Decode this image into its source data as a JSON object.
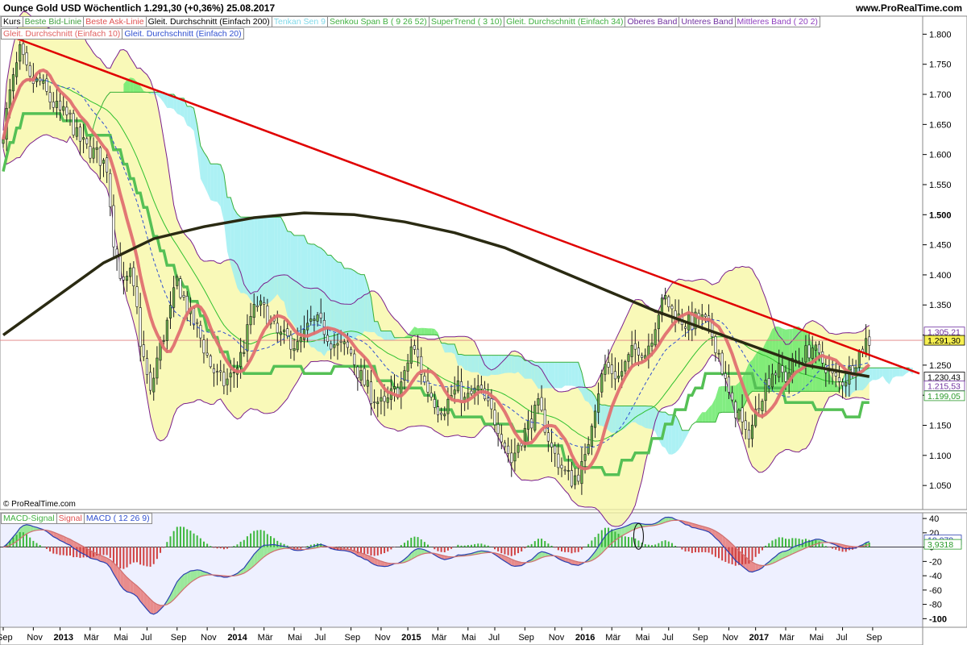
{
  "header": {
    "title": "Ounce Gold USD   Wöchentlich   1.291,30 (+0,36%)   25.08.2017",
    "site": "www.ProRealTime.com"
  },
  "legend_main": [
    {
      "label": "Kurs",
      "color": "#000000"
    },
    {
      "label": "Beste Bid-Linie",
      "color": "#40a040"
    },
    {
      "label": "Beste Ask-Linie",
      "color": "#e05050"
    },
    {
      "label": "Gleit. Durchschnitt (Einfach 200)",
      "color": "#000000"
    },
    {
      "label": "Tenkan Sen 9",
      "color": "#7fd8e8"
    },
    {
      "label": "Senkou Span B ( 9 26 52)",
      "color": "#40b040"
    },
    {
      "label": "SuperTrend ( 3 10)",
      "color": "#40b040"
    },
    {
      "label": "Gleit. Durchschnitt (Einfach 34)",
      "color": "#40b040"
    },
    {
      "label": "Oberes Band",
      "color": "#7030a0"
    },
    {
      "label": "Unteres Band",
      "color": "#7030a0"
    },
    {
      "label": "Mittleres Band ( 20 2)",
      "color": "#9040c0"
    }
  ],
  "legend_main2": [
    {
      "label": "Gleit. Durchschnitt (Einfach 10)",
      "color": "#e06060"
    },
    {
      "label": "Gleit. Durchschnitt (Einfach 20)",
      "color": "#3050d0"
    }
  ],
  "legend_macd": [
    {
      "label": "MACD-Signal",
      "color": "#40b040"
    },
    {
      "label": "Signal",
      "color": "#e05050"
    },
    {
      "label": "MACD ( 12 26 9)",
      "color": "#3050d0"
    }
  ],
  "copyright": "© ProRealTime.com",
  "colors": {
    "up": "#3fa33f",
    "down": "#222222",
    "trend": "#e00000",
    "ma200": "#2a2a12",
    "ma10": "#e07070",
    "ma20": "#3050d0",
    "supertrend": "#55c055",
    "boll_fill": "#f7f7a0",
    "boll_line": "#7a1f8c",
    "cloud_green": "#6cea6c",
    "cloud_cyan": "#9eeef2",
    "macd": "#2b3fb0",
    "signal": "#d07070",
    "hist_up": "#3cb83c",
    "hist_down": "#d04040"
  },
  "chart_data": {
    "type": "candlestick",
    "price_ticks": [
      "1.800",
      "1.750",
      "1.700",
      "1.650",
      "1.600",
      "1.550",
      "1.500",
      "1.450",
      "1.400",
      "1.350",
      "1.300",
      "1.250",
      "1.200",
      "1.150",
      "1.100",
      "1.050"
    ],
    "price_bold_tick": "1.500",
    "ylim": [
      1010,
      1830
    ],
    "macd_ticks": [
      "40",
      "20",
      "0",
      "-20",
      "-40",
      "-60",
      "-80",
      "-100"
    ],
    "macd_ylim": [
      -112,
      48
    ],
    "x_ticks": [
      {
        "week": 0,
        "label": "Sep"
      },
      {
        "week": 9,
        "label": "Nov"
      },
      {
        "week": 17,
        "label": "2013",
        "bold": true
      },
      {
        "week": 26,
        "label": "Mär"
      },
      {
        "week": 35,
        "label": "Mai"
      },
      {
        "week": 43,
        "label": "Jul"
      },
      {
        "week": 52,
        "label": "Sep"
      },
      {
        "week": 61,
        "label": "Nov"
      },
      {
        "week": 69,
        "label": "2014",
        "bold": true
      },
      {
        "week": 78,
        "label": "Mär"
      },
      {
        "week": 87,
        "label": "Mai"
      },
      {
        "week": 95,
        "label": "Jul"
      },
      {
        "week": 104,
        "label": "Sep"
      },
      {
        "week": 113,
        "label": "Nov"
      },
      {
        "week": 121,
        "label": "2015",
        "bold": true
      },
      {
        "week": 130,
        "label": "Mär"
      },
      {
        "week": 139,
        "label": "Mai"
      },
      {
        "week": 147,
        "label": "Jul"
      },
      {
        "week": 156,
        "label": "Sep"
      },
      {
        "week": 165,
        "label": "Nov"
      },
      {
        "week": 173,
        "label": "2016",
        "bold": true
      },
      {
        "week": 182,
        "label": "Mär"
      },
      {
        "week": 191,
        "label": "Mai"
      },
      {
        "week": 199,
        "label": "Jul"
      },
      {
        "week": 208,
        "label": "Sep"
      },
      {
        "week": 217,
        "label": "Nov"
      },
      {
        "week": 225,
        "label": "2017",
        "bold": true
      },
      {
        "week": 234,
        "label": "Mär"
      },
      {
        "week": 243,
        "label": "Mai"
      },
      {
        "week": 251,
        "label": "Jul"
      },
      {
        "week": 260,
        "label": "Sep"
      }
    ],
    "weeks_total": 274,
    "close_anchors": [
      [
        0,
        1640
      ],
      [
        2,
        1700
      ],
      [
        5,
        1770
      ],
      [
        8,
        1720
      ],
      [
        11,
        1720
      ],
      [
        14,
        1690
      ],
      [
        17,
        1670
      ],
      [
        20,
        1660
      ],
      [
        22,
        1630
      ],
      [
        25,
        1610
      ],
      [
        28,
        1600
      ],
      [
        31,
        1580
      ],
      [
        33,
        1460
      ],
      [
        34,
        1430
      ],
      [
        36,
        1380
      ],
      [
        38,
        1400
      ],
      [
        40,
        1340
      ],
      [
        41,
        1290
      ],
      [
        43,
        1230
      ],
      [
        44,
        1200
      ],
      [
        46,
        1260
      ],
      [
        48,
        1300
      ],
      [
        50,
        1340
      ],
      [
        52,
        1390
      ],
      [
        54,
        1360
      ],
      [
        56,
        1330
      ],
      [
        58,
        1310
      ],
      [
        60,
        1280
      ],
      [
        62,
        1250
      ],
      [
        64,
        1230
      ],
      [
        66,
        1220
      ],
      [
        68,
        1230
      ],
      [
        70,
        1250
      ],
      [
        72,
        1280
      ],
      [
        74,
        1330
      ],
      [
        76,
        1350
      ],
      [
        78,
        1340
      ],
      [
        80,
        1320
      ],
      [
        82,
        1300
      ],
      [
        84,
        1295
      ],
      [
        86,
        1290
      ],
      [
        88,
        1280
      ],
      [
        90,
        1300
      ],
      [
        92,
        1320
      ],
      [
        94,
        1320
      ],
      [
        96,
        1310
      ],
      [
        98,
        1290
      ],
      [
        100,
        1280
      ],
      [
        102,
        1280
      ],
      [
        104,
        1270
      ],
      [
        106,
        1240
      ],
      [
        108,
        1220
      ],
      [
        110,
        1200
      ],
      [
        112,
        1190
      ],
      [
        114,
        1180
      ],
      [
        116,
        1200
      ],
      [
        118,
        1210
      ],
      [
        120,
        1230
      ],
      [
        122,
        1280
      ],
      [
        124,
        1260
      ],
      [
        126,
        1220
      ],
      [
        128,
        1200
      ],
      [
        130,
        1180
      ],
      [
        132,
        1180
      ],
      [
        134,
        1200
      ],
      [
        136,
        1210
      ],
      [
        138,
        1190
      ],
      [
        140,
        1200
      ],
      [
        142,
        1210
      ],
      [
        144,
        1190
      ],
      [
        146,
        1170
      ],
      [
        148,
        1150
      ],
      [
        150,
        1120
      ],
      [
        152,
        1090
      ],
      [
        154,
        1120
      ],
      [
        156,
        1140
      ],
      [
        158,
        1160
      ],
      [
        160,
        1180
      ],
      [
        162,
        1150
      ],
      [
        164,
        1110
      ],
      [
        166,
        1090
      ],
      [
        168,
        1070
      ],
      [
        170,
        1060
      ],
      [
        172,
        1070
      ],
      [
        174,
        1090
      ],
      [
        176,
        1160
      ],
      [
        178,
        1210
      ],
      [
        180,
        1250
      ],
      [
        182,
        1240
      ],
      [
        184,
        1230
      ],
      [
        186,
        1250
      ],
      [
        188,
        1270
      ],
      [
        190,
        1280
      ],
      [
        192,
        1270
      ],
      [
        194,
        1300
      ],
      [
        196,
        1340
      ],
      [
        198,
        1360
      ],
      [
        200,
        1340
      ],
      [
        202,
        1330
      ],
      [
        204,
        1320
      ],
      [
        206,
        1320
      ],
      [
        208,
        1330
      ],
      [
        210,
        1320
      ],
      [
        212,
        1300
      ],
      [
        214,
        1270
      ],
      [
        216,
        1220
      ],
      [
        218,
        1180
      ],
      [
        220,
        1170
      ],
      [
        222,
        1130
      ],
      [
        224,
        1150
      ],
      [
        226,
        1190
      ],
      [
        228,
        1220
      ],
      [
        230,
        1240
      ],
      [
        232,
        1240
      ],
      [
        234,
        1230
      ],
      [
        236,
        1250
      ],
      [
        238,
        1260
      ],
      [
        240,
        1270
      ],
      [
        242,
        1280
      ],
      [
        244,
        1260
      ],
      [
        246,
        1250
      ],
      [
        248,
        1230
      ],
      [
        250,
        1220
      ],
      [
        252,
        1230
      ],
      [
        254,
        1250
      ],
      [
        256,
        1270
      ],
      [
        258,
        1290
      ],
      [
        259,
        1291
      ]
    ],
    "ma200_anchors": [
      [
        0,
        1300
      ],
      [
        15,
        1360
      ],
      [
        30,
        1420
      ],
      [
        45,
        1460
      ],
      [
        60,
        1480
      ],
      [
        75,
        1495
      ],
      [
        90,
        1503
      ],
      [
        105,
        1500
      ],
      [
        120,
        1488
      ],
      [
        135,
        1470
      ],
      [
        150,
        1445
      ],
      [
        165,
        1410
      ],
      [
        180,
        1375
      ],
      [
        195,
        1340
      ],
      [
        210,
        1310
      ],
      [
        225,
        1280
      ],
      [
        240,
        1250
      ],
      [
        259,
        1231
      ]
    ],
    "trendline": [
      [
        3,
        1795
      ],
      [
        274,
        1236
      ]
    ],
    "markers": [
      {
        "value": 1305.21,
        "label": "1.305,21",
        "bg": "#ffffff",
        "color": "#7030a0"
      },
      {
        "value": 1291.3,
        "label": "1.291,30",
        "bg": "#f6ef50",
        "color": "#000000"
      },
      {
        "value": 1230.43,
        "label": "1.230,43",
        "bg": "#ffffff",
        "color": "#000000"
      },
      {
        "value": 1215.53,
        "label": "1.215,53",
        "bg": "#ffffff",
        "color": "#7030a0"
      },
      {
        "value": 1199.05,
        "label": "1.199,05",
        "bg": "#ffffff",
        "color": "#2a9a2a"
      }
    ],
    "macd_markers": [
      {
        "value": 10.079,
        "label": "10,079",
        "color": "#2b3fb0"
      },
      {
        "value": 3.9318,
        "label": "3,9318",
        "color": "#2a9a2a"
      }
    ],
    "price_line": 1291.3
  }
}
